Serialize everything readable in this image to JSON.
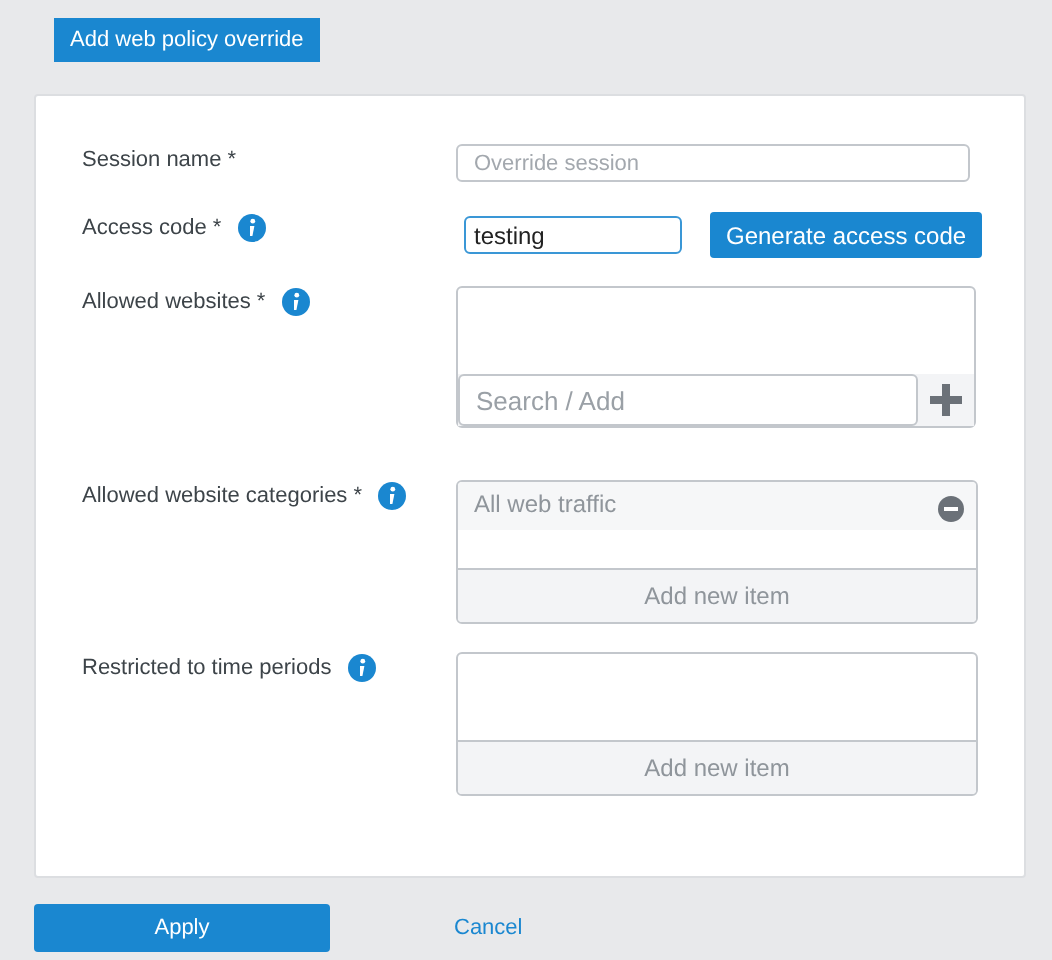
{
  "header_button": "Add web policy override",
  "fields": [
    {
      "kind": "text",
      "label": "Session name *",
      "info": false,
      "placeholder": "Override session"
    },
    {
      "kind": "code",
      "label": "Access code *",
      "info": true,
      "value": "testing",
      "button": "Generate access code"
    },
    {
      "kind": "search_list",
      "label": "Allowed websites *",
      "info": true,
      "placeholder": "Search / Add"
    },
    {
      "kind": "item_list",
      "label": "Allowed website categories *",
      "info": true,
      "items": [
        "All web traffic"
      ],
      "add_label": "Add new item"
    },
    {
      "kind": "item_list",
      "label": "Restricted to time periods",
      "info": true,
      "add_label": "Add new item"
    }
  ],
  "actions": {
    "apply": "Apply",
    "cancel": "Cancel"
  }
}
